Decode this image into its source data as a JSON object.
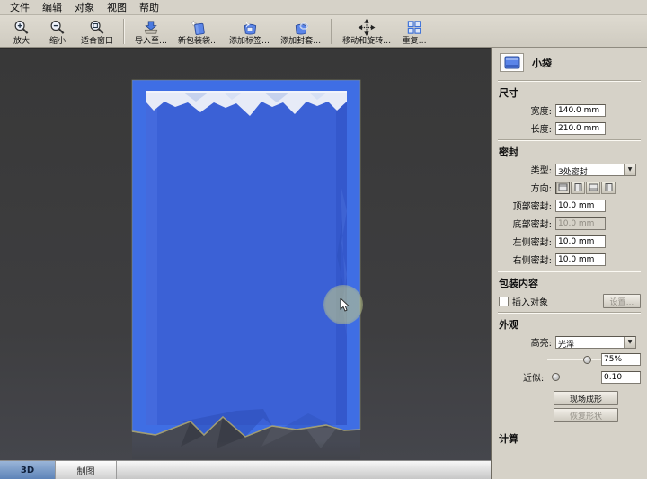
{
  "menu": {
    "items": [
      "文件",
      "编辑",
      "对象",
      "视图",
      "帮助"
    ]
  },
  "toolbar": {
    "buttons": [
      {
        "label": "放大",
        "icon": "zoom-in-icon"
      },
      {
        "label": "缩小",
        "icon": "zoom-out-icon"
      },
      {
        "label": "适合窗口",
        "icon": "fit-window-icon"
      },
      {
        "label": "导入至…",
        "icon": "import-icon"
      },
      {
        "label": "新包装袋…",
        "icon": "new-bag-icon"
      },
      {
        "label": "添加标签…",
        "icon": "add-label-icon"
      },
      {
        "label": "添加封套…",
        "icon": "add-closure-icon"
      },
      {
        "label": "移动和旋转…",
        "icon": "move-rotate-icon"
      },
      {
        "label": "重复…",
        "icon": "duplicate-icon"
      }
    ]
  },
  "panel": {
    "title": "小袋",
    "size": {
      "label": "尺寸",
      "width_label": "宽度:",
      "width_value": "140.0 mm",
      "length_label": "长度:",
      "length_value": "210.0 mm"
    },
    "seal": {
      "label": "密封",
      "type_label": "类型:",
      "type_value": "3处密封",
      "direction_label": "方向:",
      "top_label": "顶部密封:",
      "top_value": "10.0 mm",
      "bottom_label": "底部密封:",
      "bottom_value": "10.0 mm",
      "left_label": "左侧密封:",
      "left_value": "10.0 mm",
      "right_label": "右侧密封:",
      "right_value": "10.0 mm"
    },
    "content": {
      "label": "包装内容",
      "checkbox_label": "插入对象",
      "settings_button": "设置…"
    },
    "appearance": {
      "label": "外观",
      "highlight_label": "高亮:",
      "highlight_value": "光泽",
      "highlight_percent": "75%",
      "approx_label": "近似:",
      "approx_value": "0.10",
      "form_button": "现场成形",
      "restore_button": "恢复形状"
    },
    "compute": {
      "label": "计算"
    }
  },
  "tabs": [
    {
      "label": "3D",
      "active": true
    },
    {
      "label": "制图",
      "active": false
    }
  ],
  "colors": {
    "bag_outer_blue": "#3f6ee4",
    "bag_front_blue": "#3b61d6",
    "bag_seal_white": "#e7ebf7",
    "bag_edge_khaki": "#b5ad7e",
    "viewport_gray": "#3e3e40",
    "reflection_gray": "#474a55",
    "panel_gray": "#d6d2c8",
    "active_tab_blue": "#5d83b8",
    "cursor_highlight": "#bac48c"
  }
}
